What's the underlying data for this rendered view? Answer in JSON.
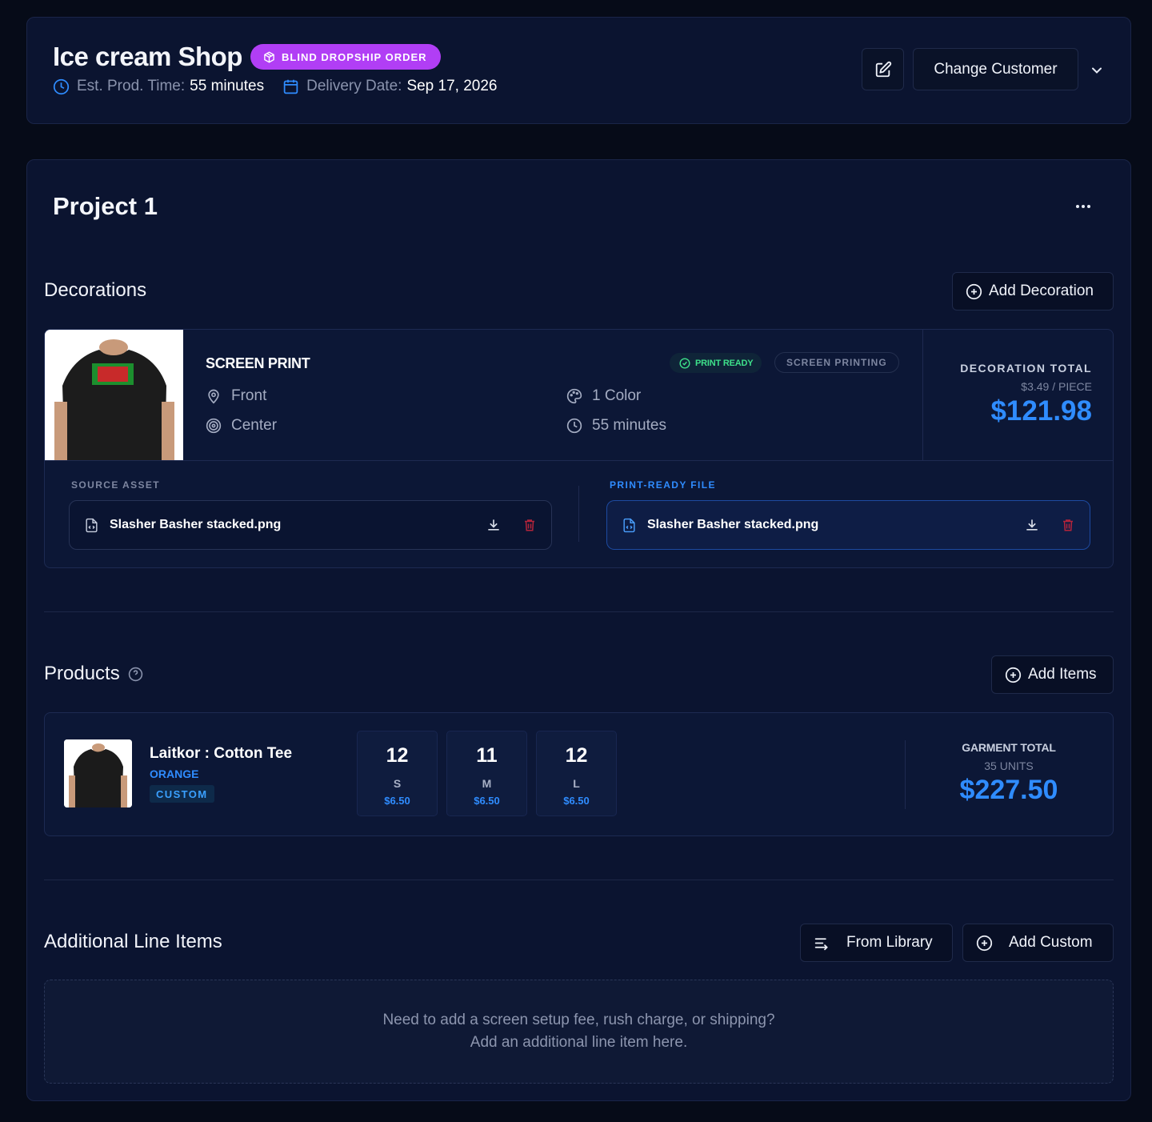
{
  "header": {
    "shop_name": "Ice cream Shop",
    "order_badge": "BLIND DROPSHIP ORDER",
    "est_prod_label": "Est. Prod. Time:",
    "est_prod_value": "55 minutes",
    "delivery_label": "Delivery Date:",
    "delivery_value": "Sep 17, 2026",
    "change_customer_label": "Change Customer",
    "edit_icon": "edit-icon",
    "badge_color": "#b13ef5"
  },
  "project": {
    "title": "Project 1",
    "decorations": {
      "section_title": "Decorations",
      "add_button": "Add Decoration",
      "item": {
        "name": "SCREEN PRINT",
        "status_pill": "PRINT READY",
        "method_pill": "SCREEN PRINTING",
        "location": "Front",
        "placement": "Center",
        "colors": "1 Color",
        "time": "55 minutes",
        "total_label": "DECORATION TOTAL",
        "per_piece": "$3.49 / PIECE",
        "total_value": "$121.98",
        "source_label": "SOURCE ASSET",
        "source_file": "Slasher Basher stacked.png",
        "print_ready_label": "PRINT-READY FILE",
        "print_ready_file": "Slasher Basher stacked.png"
      }
    },
    "products": {
      "section_title": "Products",
      "add_button": "Add Items",
      "item": {
        "name": "Laitkor : Cotton Tee",
        "color": "ORANGE",
        "tag": "CUSTOM",
        "sizes": [
          {
            "qty": "12",
            "size": "S",
            "price": "$6.50"
          },
          {
            "qty": "11",
            "size": "M",
            "price": "$6.50"
          },
          {
            "qty": "12",
            "size": "L",
            "price": "$6.50"
          }
        ],
        "total_label": "GARMENT TOTAL",
        "units": "35 UNITS",
        "total_value": "$227.50"
      }
    },
    "additional": {
      "section_title": "Additional Line Items",
      "from_library": "From Library",
      "add_custom": "Add Custom",
      "empty_line1": "Need to add a screen setup fee, rush charge, or shipping?",
      "empty_line2": "Add an additional line item here."
    }
  },
  "colors": {
    "accent_blue": "#2f8cff",
    "ready_green": "#3ee08a",
    "danger_red": "#b3243b"
  }
}
